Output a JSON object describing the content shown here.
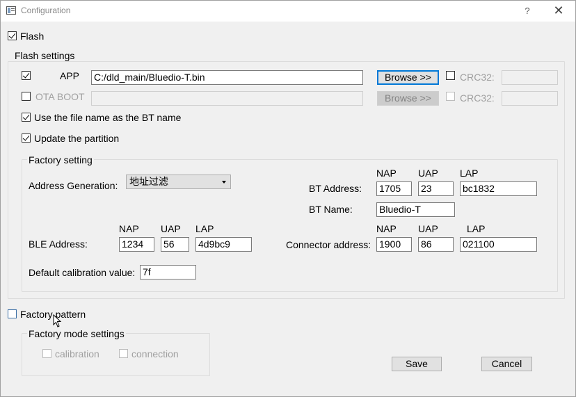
{
  "window": {
    "title": "Configuration",
    "help": "?",
    "close": "✕"
  },
  "flash": {
    "label": "Flash",
    "checked": true
  },
  "flash_settings": {
    "title": "Flash settings",
    "app": {
      "label": "APP",
      "checked": true,
      "path": "C:/dld_main/Bluedio-T.bin",
      "browse": "Browse >>",
      "crc_label": "CRC32:",
      "crc_value": ""
    },
    "ota": {
      "label": "OTA BOOT",
      "checked": false,
      "path": "",
      "browse": "Browse >>",
      "crc_label": "CRC32:",
      "crc_value": ""
    },
    "use_filename": {
      "label": "Use the file name as the BT name",
      "checked": true
    },
    "update_partition": {
      "label": "Update the partition",
      "checked": true
    }
  },
  "factory_setting": {
    "title": "Factory setting",
    "address_generation": {
      "label": "Address Generation:",
      "value": "地址过滤"
    },
    "bt_address": {
      "label": "BT Address:",
      "nap_label": "NAP",
      "uap_label": "UAP",
      "lap_label": "LAP",
      "nap": "1705",
      "uap": "23",
      "lap": "bc1832"
    },
    "bt_name": {
      "label": "BT Name:",
      "value": "Bluedio-T"
    },
    "ble_address": {
      "label": "BLE Address:",
      "nap_label": "NAP",
      "uap_label": "UAP",
      "lap_label": "LAP",
      "nap": "1234",
      "uap": "56",
      "lap": "4d9bc9"
    },
    "connector_address": {
      "label": "Connector address:",
      "nap_label": "NAP",
      "uap_label": "UAP",
      "lap_label": "LAP",
      "nap": "1900",
      "uap": "86",
      "lap": "021100"
    },
    "default_calibration": {
      "label": "Default calibration value:",
      "value": "7f"
    }
  },
  "factory_pattern": {
    "label": "Factory pattern",
    "checked": false
  },
  "factory_mode": {
    "title": "Factory mode settings",
    "calibration": {
      "label": "calibration",
      "checked": false
    },
    "connection": {
      "label": "connection",
      "checked": false
    }
  },
  "buttons": {
    "save": "Save",
    "cancel": "Cancel"
  },
  "colors": {
    "accent": "#0078d7",
    "background": "#f0f0f0"
  }
}
